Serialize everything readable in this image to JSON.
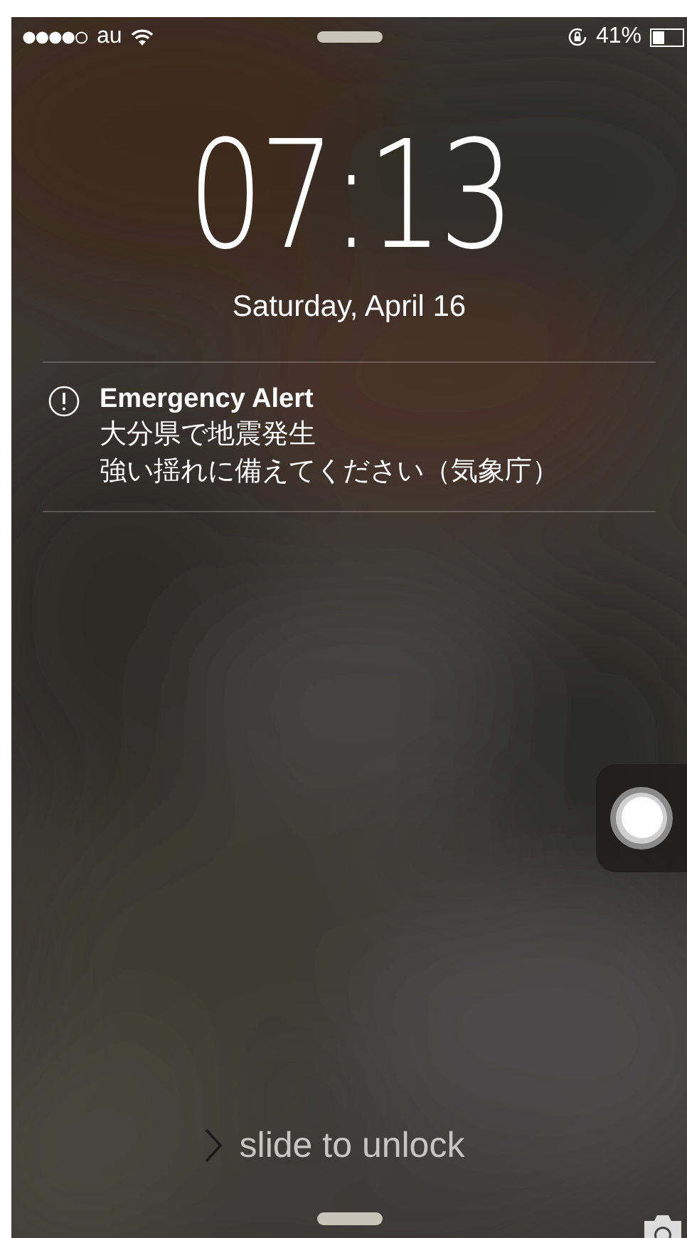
{
  "status_bar": {
    "carrier": "au",
    "battery": "41%",
    "battery_meter": {
      "level": 0.41
    }
  },
  "clock": {
    "time": "07:13",
    "date": "Saturday, April 16"
  },
  "notification": {
    "title": "Emergency Alert",
    "lines": [
      "大分県で地震発生",
      "強い揺れに備えてください（気象庁）"
    ]
  },
  "unlock_hint": "slide to unlock"
}
